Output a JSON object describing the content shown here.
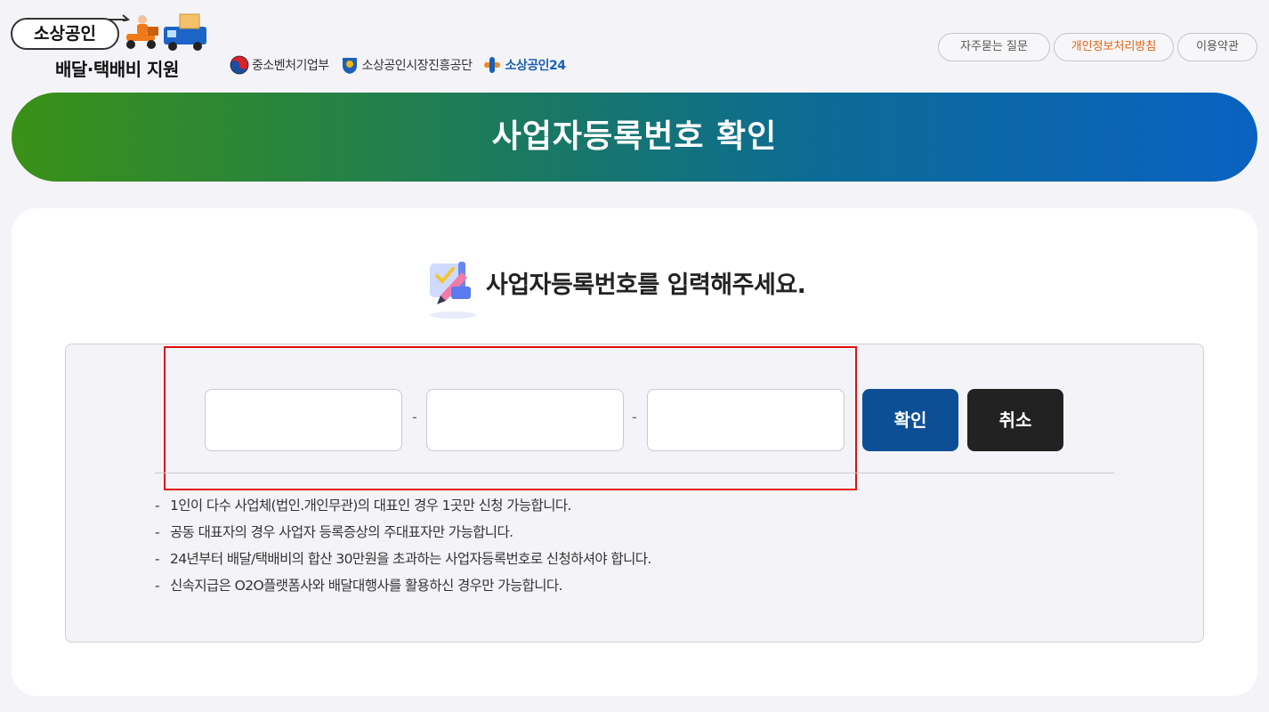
{
  "logo": {
    "pill_text": "소상공인",
    "subtitle": "배달·택배비 지원"
  },
  "orgs": [
    {
      "name": "중소벤처기업부",
      "icon": "taegeuk-icon"
    },
    {
      "name": "소상공인시장진흥공단",
      "icon": "semas-emblem-icon"
    },
    {
      "name": "소상공인24",
      "icon": "p24-logo-icon"
    }
  ],
  "toplinks": {
    "faq": "자주묻는 질문",
    "privacy": "개인정보처리방침",
    "terms": "이용약관"
  },
  "banner": {
    "title": "사업자등록번호 확인"
  },
  "form": {
    "heading": "사업자등록번호를 입력해주세요.",
    "heading_icon": "pencil-checklist-icon",
    "separator": "-",
    "inputs": [
      {
        "value": "",
        "placeholder": ""
      },
      {
        "value": "",
        "placeholder": ""
      },
      {
        "value": "",
        "placeholder": ""
      }
    ],
    "confirm_label": "확인",
    "cancel_label": "취소"
  },
  "notes": [
    "1인이 다수 사업체(법인.개인무관)의 대표인 경우 1곳만 신청 가능합니다.",
    "공동 대표자의 경우 사업자 등록증상의 주대표자만 가능합니다.",
    "24년부터 배달/택배비의 합산 30만원을 초과하는 사업자등록번호로 신청하셔야 합니다.",
    "신속지급은 O2O플랫폼사와 배달대행사를 활용하신 경우만 가능합니다."
  ],
  "colors": {
    "banner_start": "#3a9116",
    "banner_end": "#0a62c2",
    "confirm_button": "#0d4f95",
    "cancel_button": "#222222",
    "privacy_link": "#e06518",
    "highlight_border": "#e01010"
  }
}
